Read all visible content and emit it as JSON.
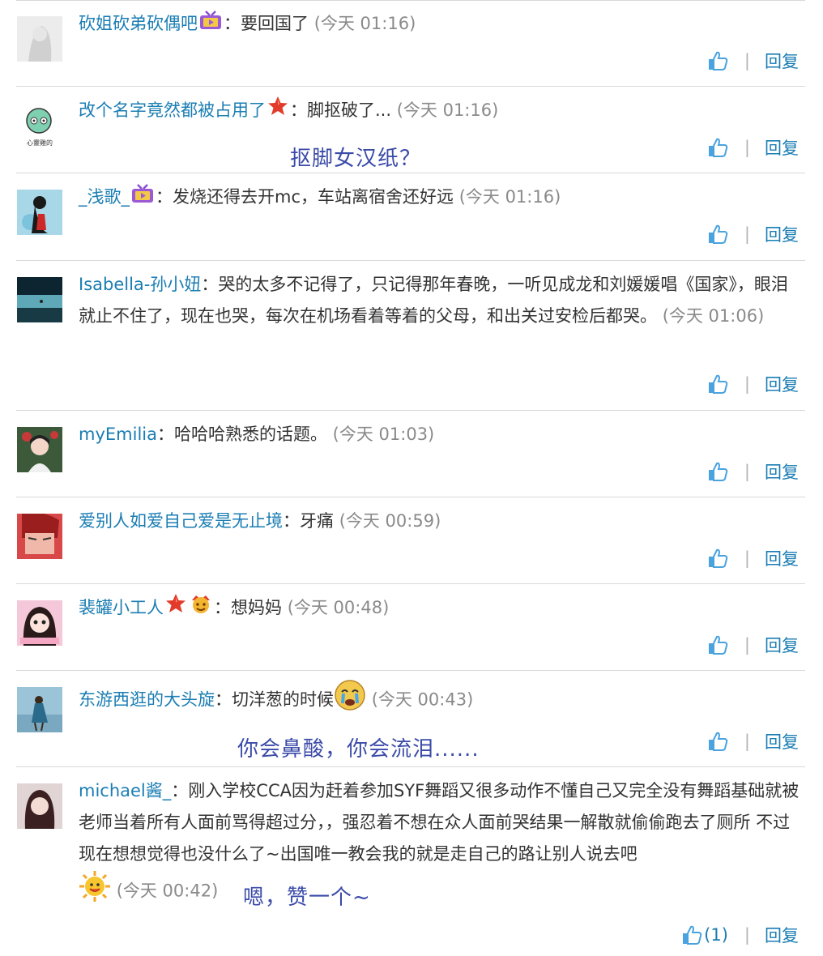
{
  "comments": [
    {
      "user": "砍姐砍弟砍偶吧",
      "text": "要回国了",
      "time": "(今天 01:16)",
      "reply": "回复"
    },
    {
      "user": "改个名字竟然都被占用了",
      "text": "脚抠破了...",
      "time": "(今天 01:16)",
      "reply": "回复",
      "avatar_label": "心靈雞的"
    },
    {
      "user": "_浅歌_",
      "text": "发烧还得去开mc，车站离宿舍还好远",
      "time": "(今天 01:16)",
      "reply": "回复"
    },
    {
      "user": "Isabella-孙小妞",
      "text": "哭的太多不记得了，只记得那年春晚，一听见成龙和刘媛媛唱《国家》，眼泪就止不住了，现在也哭，每次在机场看着等着的父母，和出关过安检后都哭。",
      "time": "(今天 01:06)",
      "reply": "回复"
    },
    {
      "user": "myEmilia",
      "text": "哈哈哈熟悉的话题。",
      "time": "(今天 01:03)",
      "reply": "回复"
    },
    {
      "user": "爱别人如爱自己爱是无止境",
      "text": "牙痛",
      "time": "(今天 00:59)",
      "reply": "回复"
    },
    {
      "user": "裴罐小工人",
      "text": "想妈妈",
      "time": "(今天 00:48)",
      "reply": "回复"
    },
    {
      "user": "东游西逛的大头旋",
      "text": "切洋葱的时候",
      "time": "(今天 00:43)",
      "reply": "回复"
    },
    {
      "user": "michael酱_",
      "text": "刚入学校CCA因为赶着参加SYF舞蹈又很多动作不懂自己又完全没有舞蹈基础就被老师当着所有人面前骂得超过分，，强忍着不想在众人面前哭结果一解散就偷偷跑去了厕所 不过现在想想觉得也没什么了~出国唯一教会我的就是走自己的路让别人说去吧",
      "time": "(今天 00:42)",
      "reply": "回复",
      "like_count": "(1)"
    }
  ],
  "captions": {
    "c1": "抠脚女汉纸？",
    "c7": "你会鼻酸，你会流泪......",
    "c8": "嗯，赞一个~"
  },
  "separator": "|",
  "colors": {
    "username": "#1a7db3",
    "caption": "#3a4aa8",
    "time": "#8a8a8a",
    "divider": "#d9d9d9",
    "like_icon": "#4aa3df"
  },
  "icons": [
    "thumbs-up-icon",
    "tv-vip-icon",
    "red-star-icon",
    "crown-face-icon",
    "crying-emoji",
    "sun-smile-emoji"
  ]
}
